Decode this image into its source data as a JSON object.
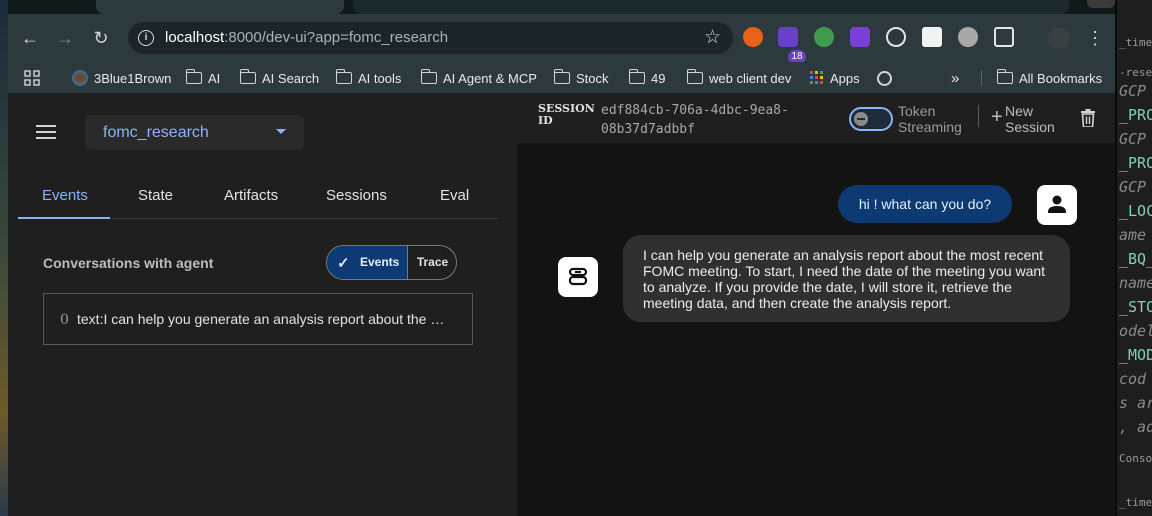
{
  "browser": {
    "url": {
      "host": "localhost",
      "rest": ":8000/dev-ui?app=fomc_research"
    },
    "extension_badge": "18",
    "bookmarks": [
      {
        "label": "3Blue1Brown",
        "icon": "3b1b-icon"
      },
      {
        "label": "AI",
        "icon": "folder-icon"
      },
      {
        "label": "AI Search",
        "icon": "folder-icon"
      },
      {
        "label": "AI tools",
        "icon": "folder-icon"
      },
      {
        "label": "AI Agent & MCP",
        "icon": "folder-icon"
      },
      {
        "label": "Stock",
        "icon": "folder-icon"
      },
      {
        "label": "49",
        "icon": "folder-icon"
      },
      {
        "label": "web client dev",
        "icon": "folder-icon"
      },
      {
        "label": "Apps",
        "icon": "apps-grid-icon"
      }
    ],
    "overflow": "»",
    "all_bookmarks": "All Bookmarks"
  },
  "sidebar": {
    "app_name": "fomc_research",
    "tabs": [
      "Events",
      "State",
      "Artifacts",
      "Sessions",
      "Eval"
    ],
    "conversations_title": "Conversations with agent",
    "view_toggle": {
      "events": "Events",
      "trace": "Trace"
    },
    "events": [
      {
        "index": "0",
        "text": "text:I can help you generate an analysis report about the most recent FOMC meeting. To start, I need the date of the meeting you want to analyze."
      }
    ]
  },
  "chat_header": {
    "session_label": "SESSION ID",
    "session_id": "edf884cb-706a-4dbc-9ea8-08b37d7adbbf",
    "token_streaming": "Token Streaming",
    "new_session": "New Session"
  },
  "chat": {
    "user_message": "hi ! what can you do?",
    "bot_message": "I can help you generate an analysis report about the most recent FOMC meeting. To start, I need the date of the meeting you want to analyze. If you provide the date, I will store it, retrieve the meeting data, and then create the analysis report."
  },
  "editor_lines": [
    {
      "text": "_times",
      "style": "plain"
    },
    {
      "text": "-resea",
      "style": "plain"
    },
    {
      "text": "GCP",
      "style": "italic"
    },
    {
      "text": "_PRO",
      "style": "teal"
    },
    {
      "text": "GCP",
      "style": "italic"
    },
    {
      "text": "_PRO",
      "style": "teal"
    },
    {
      "text": "GCP",
      "style": "italic"
    },
    {
      "text": "_LOC",
      "style": "teal"
    },
    {
      "text": "ame",
      "style": "italic"
    },
    {
      "text": "_BQ_",
      "style": "teal"
    },
    {
      "text": "name",
      "style": "italic"
    },
    {
      "text": "_STO",
      "style": "teal"
    },
    {
      "text": "odel",
      "style": "italic"
    },
    {
      "text": "_MOD",
      "style": "teal"
    },
    {
      "text": " cod",
      "style": "italic"
    },
    {
      "text": "s ar",
      "style": "italic"
    },
    {
      "text": ", ad",
      "style": "italic"
    },
    {
      "text": "Conso",
      "style": "plain"
    },
    {
      "text": "_time",
      "style": "plain"
    }
  ],
  "colors": {
    "accent": "#8ab4f8",
    "user_bubble": "#0d3a73",
    "bot_bubble": "#303030"
  }
}
